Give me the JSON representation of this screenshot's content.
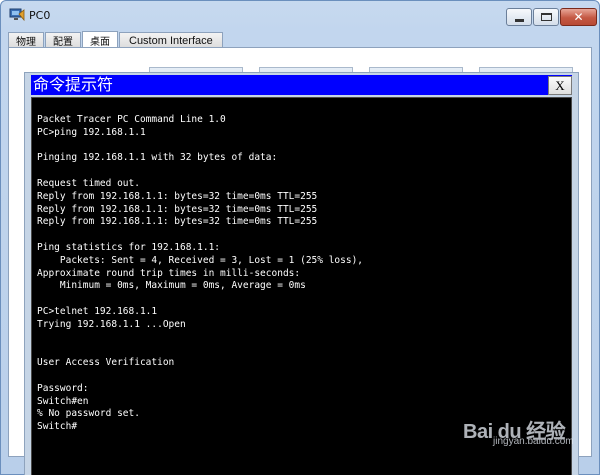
{
  "window": {
    "title": "PC0",
    "minimize_label": "",
    "maximize_label": "",
    "close_glyph": "✕"
  },
  "tabs": [
    {
      "label": "物理"
    },
    {
      "label": "配置"
    },
    {
      "label": "桌面",
      "active": true
    },
    {
      "label": "Custom Interface"
    }
  ],
  "command_prompt": {
    "title": "命令提示符",
    "close_label": "X",
    "title_color": "#0000ff",
    "lines": [
      "Packet Tracer PC Command Line 1.0",
      "PC>ping 192.168.1.1",
      "",
      "Pinging 192.168.1.1 with 32 bytes of data:",
      "",
      "Request timed out.",
      "Reply from 192.168.1.1: bytes=32 time=0ms TTL=255",
      "Reply from 192.168.1.1: bytes=32 time=0ms TTL=255",
      "Reply from 192.168.1.1: bytes=32 time=0ms TTL=255",
      "",
      "Ping statistics for 192.168.1.1:",
      "    Packets: Sent = 4, Received = 3, Lost = 1 (25% loss),",
      "Approximate round trip times in milli-seconds:",
      "    Minimum = 0ms, Maximum = 0ms, Average = 0ms",
      "",
      "PC>telnet 192.168.1.1",
      "Trying 192.168.1.1 ...Open",
      "",
      "",
      "User Access Verification",
      "",
      "Password:",
      "Switch#en",
      "% No password set.",
      "Switch#"
    ]
  },
  "watermark": {
    "text": "Bai du 经验",
    "sub": "jingyan.baidu.com"
  }
}
